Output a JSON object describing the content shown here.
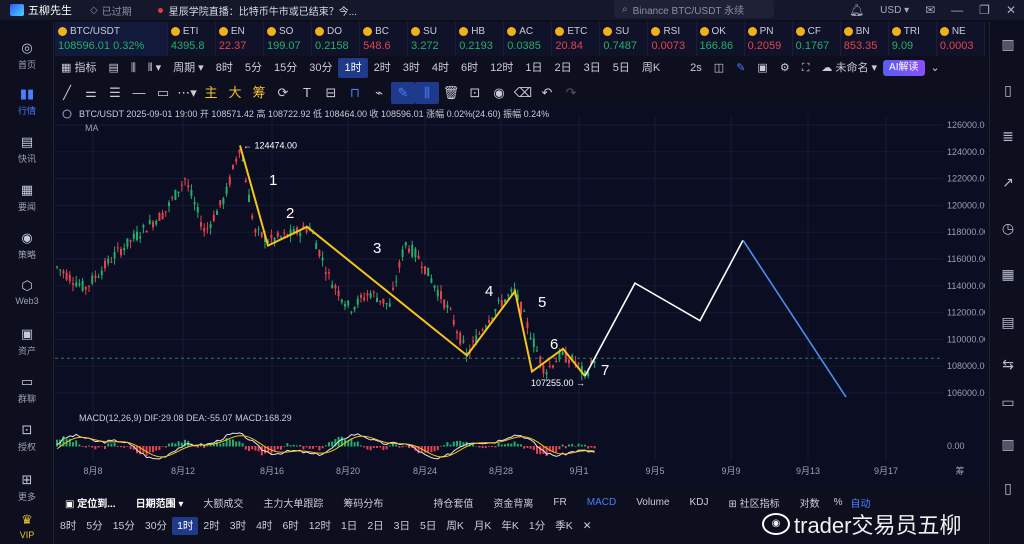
{
  "app": {
    "name": "五柳先生",
    "expired": "已过期"
  },
  "news": {
    "text": "星辰学院直播：比特币牛市或已结束？今..."
  },
  "search": {
    "placeholder": "Binance BTC/USDT 永续"
  },
  "currency": "USD",
  "left_nav": [
    {
      "label": "首页",
      "icon": "home-icon"
    },
    {
      "label": "行情",
      "icon": "chart-icon",
      "active": true
    },
    {
      "label": "快讯",
      "icon": "flash-news-icon"
    },
    {
      "label": "要闻",
      "icon": "news-icon"
    },
    {
      "label": "策略",
      "icon": "strategy-icon"
    },
    {
      "label": "Web3",
      "icon": "web3-icon"
    },
    {
      "label": "资产",
      "icon": "wallet-icon"
    },
    {
      "label": "群聊",
      "icon": "chat-icon"
    },
    {
      "label": "授权",
      "icon": "auth-icon"
    },
    {
      "label": "更多",
      "icon": "more-icon"
    },
    {
      "label": "VIP",
      "icon": "vip-icon"
    }
  ],
  "tickers": [
    {
      "name": "BTC/USDT",
      "price": "108596.01",
      "change": "0.32%",
      "dir": "up"
    },
    {
      "name": "ETI",
      "price": "4395.8",
      "dir": "up"
    },
    {
      "name": "EN",
      "price": "22.37",
      "dir": "dn"
    },
    {
      "name": "SO",
      "price": "199.07",
      "dir": "up"
    },
    {
      "name": "DO",
      "price": "0.2158",
      "dir": "up"
    },
    {
      "name": "BC",
      "price": "548.6",
      "dir": "dn"
    },
    {
      "name": "SU",
      "price": "3.272",
      "dir": "up"
    },
    {
      "name": "HB",
      "price": "0.2193",
      "dir": "up"
    },
    {
      "name": "AC",
      "price": "0.0385",
      "dir": "up"
    },
    {
      "name": "ETC",
      "price": "20.84",
      "dir": "dn"
    },
    {
      "name": "SU",
      "price": "0.7487",
      "dir": "up"
    },
    {
      "name": "RSI",
      "price": "0.0073",
      "dir": "dn"
    },
    {
      "name": "OK",
      "price": "166.86",
      "dir": "up"
    },
    {
      "name": "PN",
      "price": "0.2059",
      "dir": "dn"
    },
    {
      "name": "CF",
      "price": "0.1767",
      "dir": "up"
    },
    {
      "name": "BN",
      "price": "853.35",
      "dir": "dn"
    },
    {
      "name": "TRI",
      "price": "9.09",
      "dir": "up"
    },
    {
      "name": "NE",
      "price": "0.0003",
      "dir": "dn"
    }
  ],
  "toolbar": {
    "items": [
      "指标",
      "周期",
      "8时",
      "5分",
      "15分",
      "30分",
      "1时",
      "2时",
      "3时",
      "4时",
      "6时",
      "12时",
      "1日",
      "2日",
      "3日",
      "5日",
      "周K",
      "2s"
    ],
    "selected": "1时",
    "unnamed": "未命名",
    "ai": "AI解读"
  },
  "drawtools": [
    "主",
    "大",
    "筹"
  ],
  "chart_info": {
    "symbol": "BTC/USDT",
    "datetime": "2025-09-01 19:00",
    "open_label": "开",
    "open": "108571.42",
    "high_label": "高",
    "high": "108722.92",
    "low_label": "低",
    "low": "108464.00",
    "close_label": "收",
    "close": "108596.01",
    "change_label": "涨幅",
    "change": "0.02%(24.60)",
    "amp_label": "振幅",
    "amp": "0.24%",
    "ma_label": "MA"
  },
  "chart_data": {
    "type": "line",
    "price_axis": [
      "126000.00",
      "124000.00",
      "122000.00",
      "120000.00",
      "118000.00",
      "116000.00",
      "114000.00",
      "112000.00",
      "110000.00",
      "108000.00",
      "106000.00"
    ],
    "date_axis": [
      "8月8",
      "8月12",
      "8月16",
      "8月20",
      "8月24",
      "8月28",
      "9月1",
      "9月5",
      "9月9",
      "9月13",
      "9月17"
    ],
    "high_marker": "124474.00",
    "low_marker": "107255.00",
    "wave_labels": [
      "1",
      "2",
      "3",
      "4",
      "5",
      "6",
      "7"
    ],
    "yellow_path_prices": [
      124474,
      117000,
      118400,
      108800,
      113600,
      107600,
      109300,
      107255
    ],
    "white_path_prices": [
      107255,
      114200,
      111400,
      117400
    ],
    "blue_path_prices": [
      117400,
      105700
    ],
    "current_price": 108596,
    "macd": {
      "label": "MACD(12,26,9)",
      "dif": "DIF:29.08",
      "dea": "DEA:-55.07",
      "macd": "MACD:168.29",
      "zero": "0.00"
    }
  },
  "bottom_tabs": [
    "定位到...",
    "日期范围",
    "大额成交",
    "主力大单跟踪",
    "筹码分布",
    "持仓套值",
    "资金背离",
    "FR",
    "MACD",
    "Volume",
    "KDJ",
    "社区指标",
    "对数",
    "%",
    "自动"
  ],
  "bottom_periods": [
    "8时",
    "5分",
    "15分",
    "30分",
    "1时",
    "2时",
    "3时",
    "4时",
    "6时",
    "12时",
    "1日",
    "2日",
    "3日",
    "5日",
    "周K",
    "月K",
    "年K",
    "1分",
    "季K"
  ],
  "watermark": "trader交易员五柳",
  "axis_extra": "筹"
}
